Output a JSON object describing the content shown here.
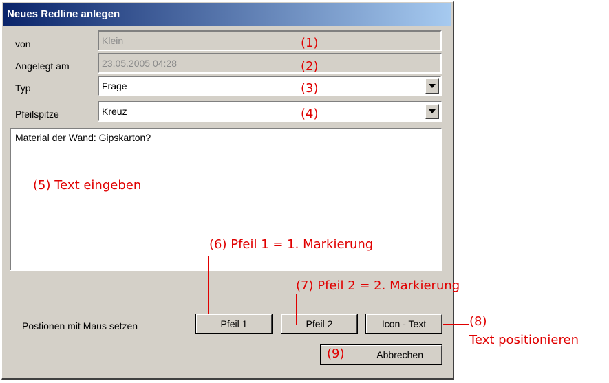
{
  "dialog": {
    "title": "Neues Redline anlegen",
    "fields": {
      "von_label": "von",
      "von_value": "Klein",
      "angelegt_label": "Angelegt am",
      "angelegt_value": "23.05.2005 04:28",
      "typ_label": "Typ",
      "typ_value": "Frage",
      "pfeilspitze_label": "Pfeilspitze",
      "pfeilspitze_value": "Kreuz"
    },
    "textarea_value": "Material der Wand: Gipskarton?",
    "position_label": "Postionen mit Maus setzen",
    "buttons": {
      "pfeil1": "Pfeil 1",
      "pfeil2": "Pfeil 2",
      "icon_text": "Icon - Text",
      "abbrechen": "Abbrechen"
    }
  },
  "annotations": {
    "a1": "(1)",
    "a2": "(2)",
    "a3": "(3)",
    "a4": "(4)",
    "a5": "(5) Text eingeben",
    "a6": "(6) Pfeil 1 = 1. Markierung",
    "a7": "(7) Pfeil 2 = 2. Markierung",
    "a8": "(8)",
    "a8b": "Text positionieren",
    "a9": "(9)"
  },
  "colors": {
    "annotation": "#e00000",
    "titlebar_start": "#0a246a",
    "titlebar_end": "#a6caf0",
    "dialog_bg": "#d4d0c8"
  }
}
